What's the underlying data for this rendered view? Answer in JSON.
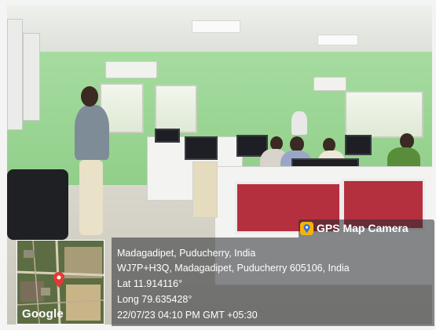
{
  "photo": {
    "description_colors": {
      "wall": "#8fcd87",
      "cubicle": "#b4303f",
      "floor": "#c9c5ba"
    }
  },
  "badge": {
    "label": "GPS Map Camera",
    "icon": "map-pin-icon"
  },
  "map": {
    "brand": "Google",
    "marker_icon": "map-marker-icon"
  },
  "stamp": {
    "place": "Madagadipet, Puducherry, India",
    "address": "WJ7P+H3Q, Madagadipet, Puducherry 605106, India",
    "lat": "Lat 11.914116°",
    "long": "Long 79.635428°",
    "datetime": "22/07/23 04:10 PM GMT +05:30"
  }
}
